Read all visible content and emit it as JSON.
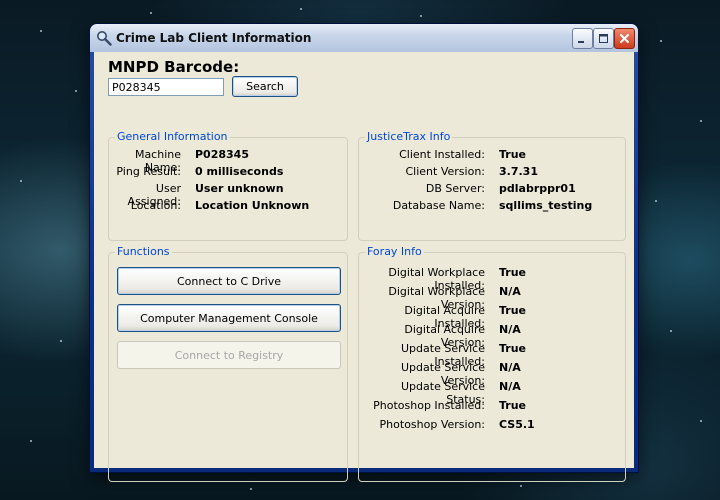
{
  "window": {
    "title": "Crime Lab Client Information"
  },
  "barcode": {
    "label": "MNPD Barcode:",
    "value": "P028345",
    "search_label": "Search"
  },
  "general": {
    "title": "General Information",
    "rows": [
      {
        "label": "Machine Name:",
        "value": "P028345"
      },
      {
        "label": "Ping Result:",
        "value": "0 milliseconds"
      },
      {
        "label": "User Assigned:",
        "value": "User unknown"
      },
      {
        "label": "Location:",
        "value": "Location Unknown"
      }
    ]
  },
  "justicetrax": {
    "title": "JusticeTrax Info",
    "rows": [
      {
        "label": "Client Installed:",
        "value": "True"
      },
      {
        "label": "Client Version:",
        "value": "3.7.31"
      },
      {
        "label": "DB Server:",
        "value": "pdlabrppr01"
      },
      {
        "label": "Database Name:",
        "value": "sqllims_testing"
      }
    ]
  },
  "functions": {
    "title": "Functions",
    "buttons": [
      {
        "label": "Connect to C Drive",
        "enabled": true
      },
      {
        "label": "Computer Management Console",
        "enabled": true
      },
      {
        "label": "Connect to Registry",
        "enabled": false
      }
    ]
  },
  "foray": {
    "title": "Foray Info",
    "rows": [
      {
        "label": "Digital Workplace Installed:",
        "value": "True"
      },
      {
        "label": "Digital Workplace Version:",
        "value": "N/A"
      },
      {
        "label": "Digital Acquire Installed:",
        "value": "True"
      },
      {
        "label": "Digital Acquire Version:",
        "value": "N/A"
      },
      {
        "label": "Update Service Installed:",
        "value": "True"
      },
      {
        "label": "Update Service Version:",
        "value": "N/A"
      },
      {
        "label": "Update Service Status:",
        "value": "N/A"
      },
      {
        "label": "Photoshop Installed:",
        "value": "True"
      },
      {
        "label": "Photoshop Version:",
        "value": "CS5.1"
      }
    ]
  }
}
